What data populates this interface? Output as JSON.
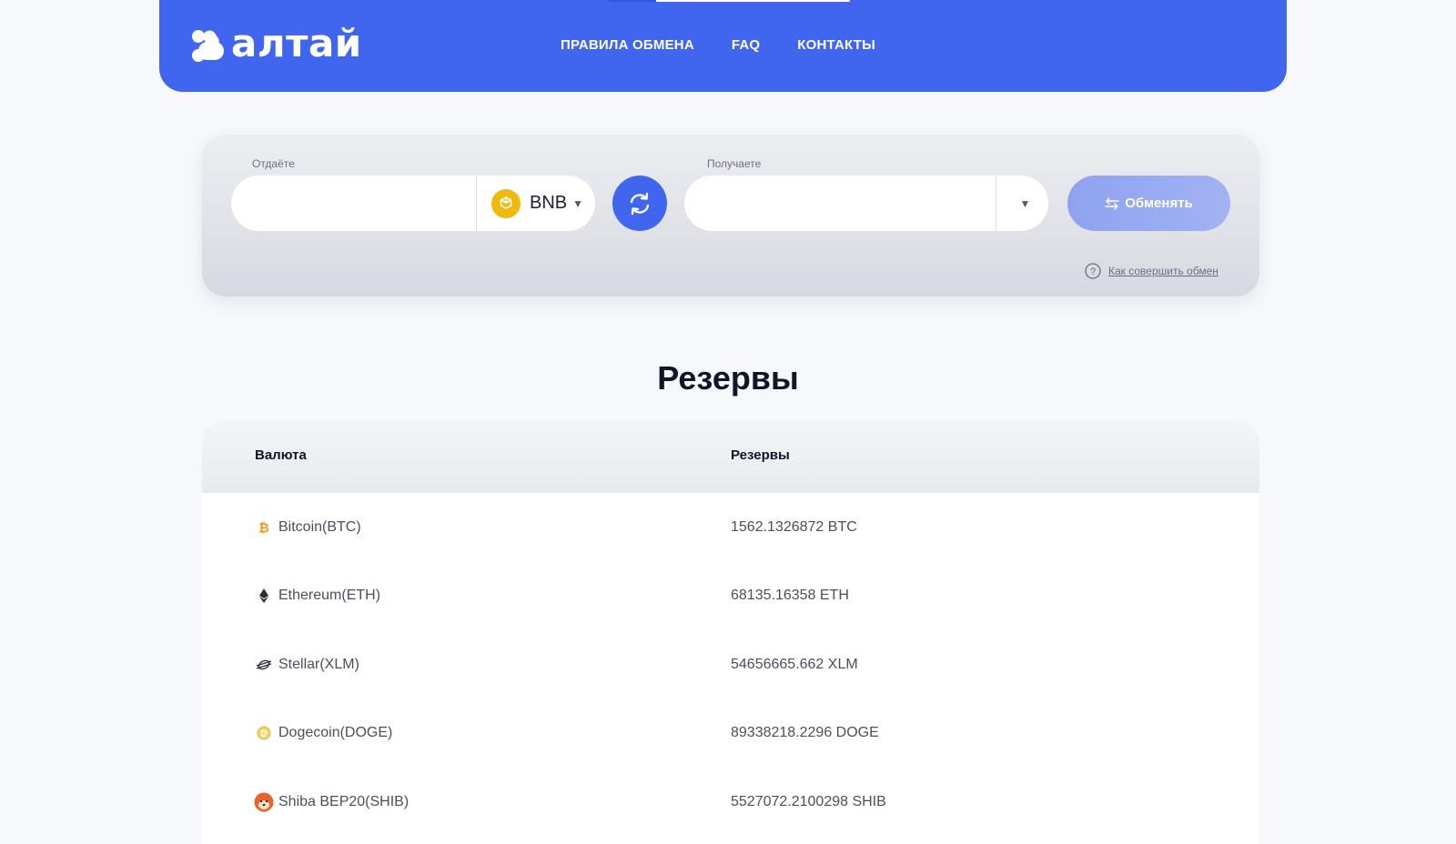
{
  "header": {
    "logo_text": "алтай",
    "nav": [
      "ПРАВИЛА ОБМЕНА",
      "FAQ",
      "КОНТАКТЫ"
    ],
    "brand_color": "#4066f0"
  },
  "exchange": {
    "give_label": "Отдаёте",
    "give_value": "",
    "give_currency": "BNB",
    "get_label": "Получаете",
    "get_value": "",
    "get_currency": "",
    "exchange_button": "Обменять",
    "how_to_link": "Как совершить обмен"
  },
  "reserves": {
    "title": "Резервы",
    "columns": [
      "Валюта",
      "Резервы"
    ],
    "rows": [
      {
        "currency": "Bitcoin(BTC)",
        "reserve": "1562.1326872 BTC",
        "icon": "bitcoin-icon"
      },
      {
        "currency": "Ethereum(ETH)",
        "reserve": "68135.16358 ETH",
        "icon": "ethereum-icon"
      },
      {
        "currency": "Stellar(XLM)",
        "reserve": "54656665.662 XLM",
        "icon": "stellar-icon"
      },
      {
        "currency": "Dogecoin(DOGE)",
        "reserve": "89338218.2296 DOGE",
        "icon": "dogecoin-icon"
      },
      {
        "currency": "Shiba BEP20(SHIB)",
        "reserve": "5527072.2100298 SHIB",
        "icon": "shiba-icon"
      }
    ]
  }
}
